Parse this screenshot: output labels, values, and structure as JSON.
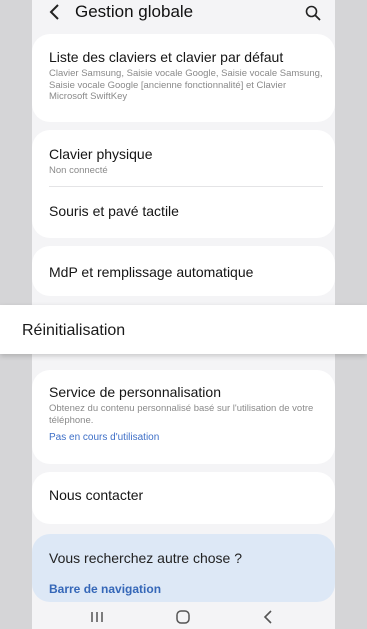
{
  "header": {
    "title": "Gestion globale",
    "back_icon": "arrow-left-icon",
    "search_icon": "search-icon"
  },
  "keyboards": {
    "title": "Liste des claviers et clavier par défaut",
    "subtitle": "Clavier Samsung, Saisie vocale Google, Saisie vocale Samsung, Saisie vocale Google [ancienne fonctionnalité] et Clavier Microsoft SwiftKey"
  },
  "physical_keyboard": {
    "title": "Clavier physique",
    "subtitle": "Non connecté"
  },
  "mouse": {
    "title": "Souris et pavé tactile"
  },
  "passwords": {
    "title": "MdP et remplissage automatique"
  },
  "reset": {
    "label": "Réinitialisation"
  },
  "personalization": {
    "title": "Service de personnalisation",
    "subtitle": "Obtenez du contenu personnalisé basé sur l'utilisation de votre téléphone.",
    "status": "Pas en cours d'utilisation"
  },
  "contact": {
    "title": "Nous contacter"
  },
  "suggestions": {
    "title": "Vous recherchez autre chose ?",
    "link": "Barre de navigation"
  },
  "navbar": {
    "recents_icon": "recents-icon",
    "home_icon": "home-icon",
    "back_icon": "back-icon"
  },
  "colors": {
    "background": "#f4f4f6",
    "card": "#ffffff",
    "accent": "#3e6fc7",
    "suggestion_card": "#dde8f6"
  }
}
